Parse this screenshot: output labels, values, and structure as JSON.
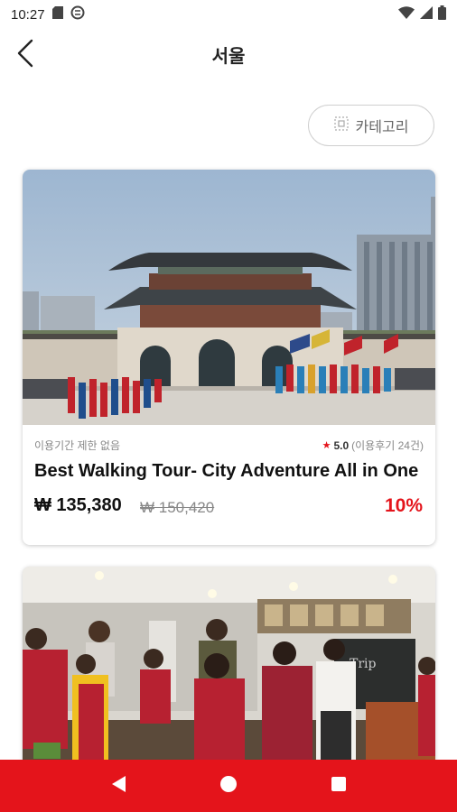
{
  "status_bar": {
    "time": "10:27",
    "icons_left": [
      "sd-card-icon",
      "sync-icon"
    ],
    "icons_right": [
      "wifi-icon",
      "signal-icon",
      "battery-icon"
    ]
  },
  "header": {
    "title": "서울",
    "back_icon": "back-arrow-icon"
  },
  "category_button": {
    "label": "카테고리",
    "icon": "category-grid-icon"
  },
  "cards": [
    {
      "image": "gwanghwamun-gate-photo",
      "duration": "이용기간 제한 없음",
      "rating": "5.0",
      "reviews": "(이용후기 24건)",
      "title": "Best Walking Tour- City Adventure All in One",
      "price": "₩ 135,380",
      "original_price": "₩ 150,420",
      "discount": "10%"
    },
    {
      "image": "cooking-class-group-photo"
    }
  ],
  "nav_bar": {
    "buttons": [
      "back-triangle-icon",
      "home-circle-icon",
      "recents-square-icon"
    ]
  },
  "colors": {
    "accent": "#e4141b",
    "text_muted": "#888888"
  }
}
